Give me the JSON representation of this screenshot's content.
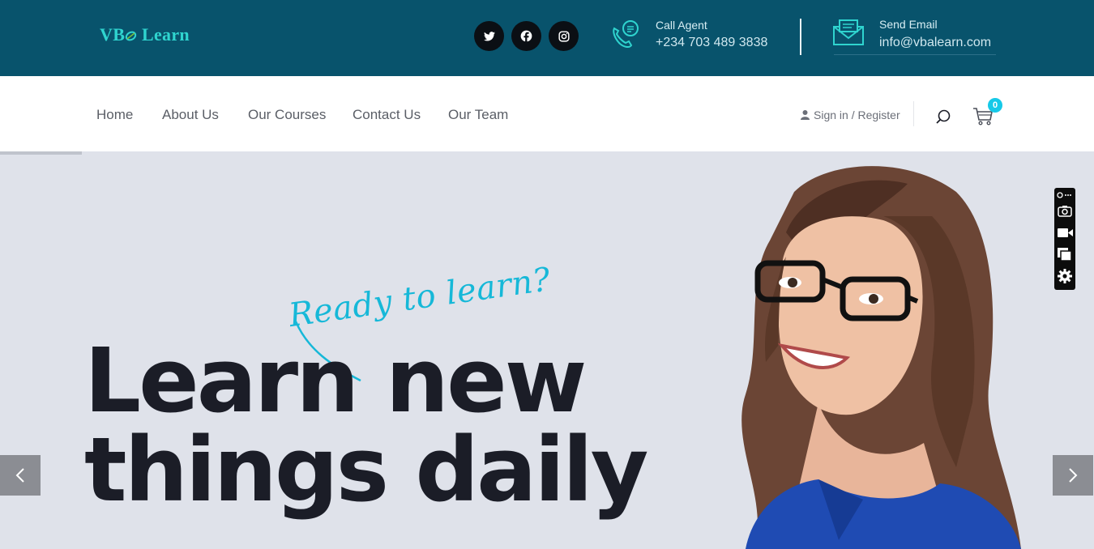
{
  "brand": {
    "name_left": "VB",
    "name_right": "Learn",
    "accent": "#2fd4cf",
    "topbar_bg": "#08536c"
  },
  "social": [
    {
      "name": "twitter",
      "icon": "twitter-icon"
    },
    {
      "name": "facebook",
      "icon": "facebook-icon"
    },
    {
      "name": "instagram",
      "icon": "instagram-icon"
    }
  ],
  "contact": {
    "call": {
      "label": "Call Agent",
      "value": "+234 703 489 3838",
      "icon": "phone-chat-icon"
    },
    "email": {
      "label": "Send Email",
      "value": "info@vbalearn.com",
      "icon": "envelope-icon"
    }
  },
  "nav": {
    "items": [
      "Home",
      "About Us",
      "Our Courses",
      "Contact Us",
      "Our Team"
    ],
    "signin": "Sign in / Register",
    "cart_count": "0",
    "badge_color": "#16c9e8"
  },
  "hero": {
    "tagline": "Ready to learn?",
    "headline_line1": "Learn new",
    "headline_line2": "things daily",
    "slide_progress": 0.075,
    "prev_icon": "chevron-left-icon",
    "next_icon": "chevron-right-icon",
    "tagline_color": "#16b8d8"
  },
  "toolbar": {
    "tools": [
      "link-more-icon",
      "camera-icon",
      "video-camera-icon",
      "copy-icon",
      "gear-icon"
    ]
  }
}
